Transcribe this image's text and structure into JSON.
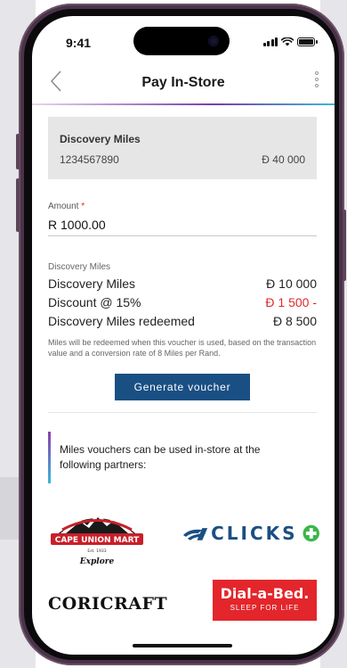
{
  "status_bar": {
    "time": "9:41"
  },
  "navbar": {
    "title": "Pay In-Store",
    "back_icon": "chevron-left-icon",
    "menu_icon": "kebab-menu-icon"
  },
  "account_card": {
    "title": "Discovery Miles",
    "account_number": "1234567890",
    "balance": "Ð 40 000"
  },
  "amount": {
    "label": "Amount",
    "required_mark": "*",
    "value": "R 1000.00"
  },
  "miles": {
    "caption": "Discovery Miles",
    "rows": [
      {
        "label": "Discovery Miles",
        "value": "Ð 10 000"
      },
      {
        "label": "Discount @ 15%",
        "value": "Ð 1 500 -"
      },
      {
        "label": "Discovery Miles redeemed",
        "value": "Ð 8 500"
      }
    ],
    "note": "Miles will be redeemed when this voucher is used, based on the transaction value and a conversion rate of 8 Miles per Rand."
  },
  "generate_button": "Generate voucher",
  "partners": {
    "text": "Miles vouchers can be used in-store at the following partners:",
    "logos": {
      "cape_union_mart": {
        "name": "CAPE UNION MART",
        "est": "Est. 1933",
        "tagline": "Explore"
      },
      "clicks": "CLICKS",
      "coricraft": "CORICRAFT",
      "dial_a_bed": {
        "name": "Dial-a-Bed.",
        "tagline": "SLEEP FOR LIFE"
      }
    }
  },
  "colors": {
    "primary": "#1a4f84",
    "negative": "#e0292a",
    "card_bg": "#e6e6e6",
    "dialbed_red": "#e3262b",
    "clicks_green": "#3bb54a"
  }
}
